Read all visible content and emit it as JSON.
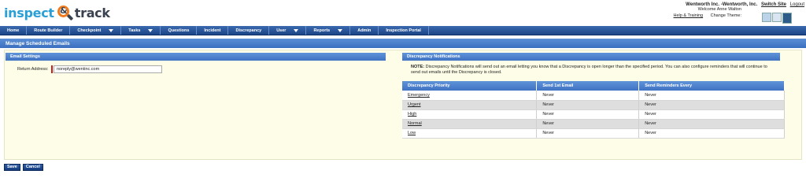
{
  "header": {
    "logo_part1": "inspect",
    "logo_amp": "&",
    "logo_part2": "track",
    "company": "Wentworth Inc. -Wentworth, Inc.",
    "switch_site": "Switch Site",
    "logout": "Logout",
    "welcome": "Welcome Anne Walton",
    "help": "Help & Training",
    "change_theme": "Change Theme:"
  },
  "nav": {
    "items": [
      {
        "label": "Home",
        "dropdown": false
      },
      {
        "label": "Route Builder",
        "dropdown": false
      },
      {
        "label": "Checkpoint",
        "dropdown": true
      },
      {
        "label": "Tasks",
        "dropdown": true
      },
      {
        "label": "Questions",
        "dropdown": false
      },
      {
        "label": "Incident",
        "dropdown": false
      },
      {
        "label": "Discrepancy",
        "dropdown": false
      },
      {
        "label": "User",
        "dropdown": true
      },
      {
        "label": "Reports",
        "dropdown": true
      },
      {
        "label": "Admin",
        "dropdown": false
      },
      {
        "label": "Inspection Portal",
        "dropdown": false
      }
    ]
  },
  "page": {
    "title": "Manage Scheduled Emails"
  },
  "email_settings": {
    "header": "Email Settings",
    "return_label": "Return Address:",
    "return_value": "noreply@wentinc.com"
  },
  "discrepancy": {
    "header": "Discrepancy Notifications",
    "note_label": "NOTE:",
    "note_text": "Discrepancy Notifications will send out an email letting you know that a Discrepancy is open longer than the specified period. You can also configure reminders that will continue to send out emails until the Discrepancy is closed.",
    "columns": [
      "Discrepancy Priority",
      "Send 1st Email",
      "Send Reminders Every"
    ],
    "rows": [
      {
        "priority": "Emergency",
        "first": "Never",
        "reminder": "Never"
      },
      {
        "priority": "Urgent",
        "first": "Never",
        "reminder": "Never"
      },
      {
        "priority": "High",
        "first": "Never",
        "reminder": "Never"
      },
      {
        "priority": "Normal",
        "first": "Never",
        "reminder": "Never"
      },
      {
        "priority": "Low",
        "first": "Never",
        "reminder": "Never"
      }
    ]
  },
  "actions": {
    "save": "Save",
    "cancel": "Cancel"
  },
  "colors": {
    "nav": "#1a4586",
    "panel_header": "#3f73c3",
    "main_bg": "#fefee8",
    "required_marker": "#c81e1e",
    "logo_blue": "#2a9fd6",
    "logo_orange": "#f07b1e"
  }
}
